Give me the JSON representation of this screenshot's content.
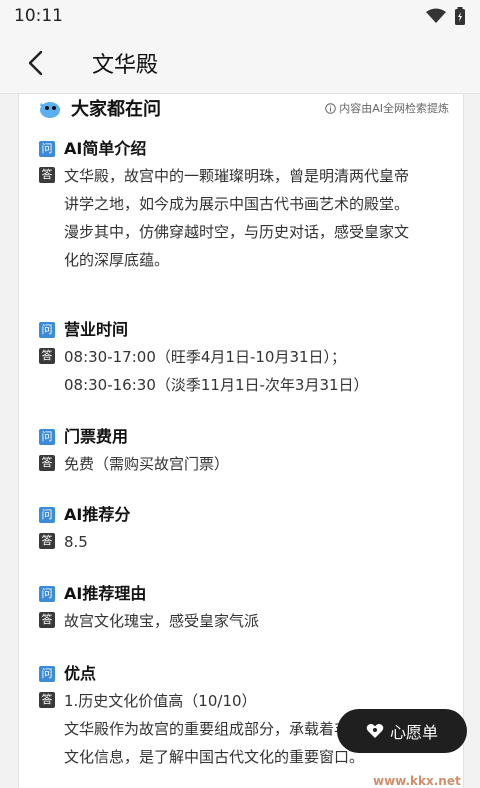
{
  "status": {
    "time": "10:11"
  },
  "header": {
    "title": "文华殿"
  },
  "card": {
    "title": "大家都在问",
    "note": "内容由AI全网检索提炼",
    "q_badge": "问",
    "a_badge": "答",
    "items": [
      {
        "question": "AI简单介绍",
        "answer": "文华殿，故宫中的一颗璀璨明珠，曾是明清两代皇帝讲学之地，如今成为展示中国古代书画艺术的殿堂。漫步其中，仿佛穿越时空，与历史对话，感受皇家文化的深厚底蕴。"
      },
      {
        "question": "营业时间",
        "answer": "08:30-17:00（旺季4月1日-10月31日）；\n08:30-16:30（淡季11月1日-次年3月31日）"
      },
      {
        "question": "门票费用",
        "answer": "免费（需购买故宫门票）"
      },
      {
        "question": "AI推荐分",
        "answer": "8.5"
      },
      {
        "question": "AI推荐理由",
        "answer": "故宫文化瑰宝，感受皇家气派"
      },
      {
        "question": "优点",
        "answer": "1.历史文化价值高（10/10）\n文华殿作为故宫的重要组成部分，承载着丰富的历史文化信息，是了解中国古代文化的重要窗口。"
      }
    ]
  },
  "wish_button": {
    "label": "心愿单"
  },
  "watermark": {
    "text": "www.kkx.net"
  },
  "colors": {
    "q_badge": "#3b8bd8",
    "a_badge": "#3a3a3a",
    "button_bg": "#1f1f1f"
  }
}
